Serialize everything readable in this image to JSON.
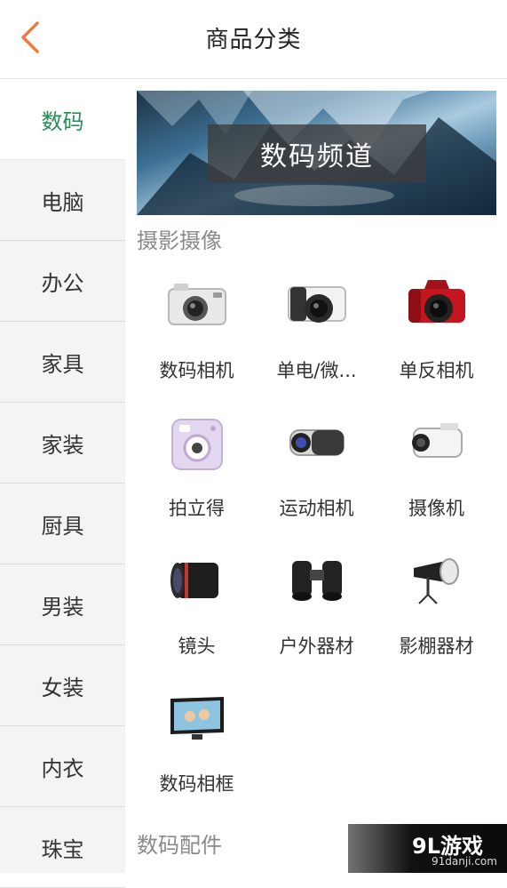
{
  "header": {
    "title": "商品分类",
    "back_icon": "chevron-left-icon",
    "accent": "#f07b3f"
  },
  "sidebar": {
    "active_color": "#2b8a57",
    "items": [
      {
        "label": "数码",
        "active": true
      },
      {
        "label": "电脑"
      },
      {
        "label": "办公"
      },
      {
        "label": "家具"
      },
      {
        "label": "家装"
      },
      {
        "label": "厨具"
      },
      {
        "label": "男装"
      },
      {
        "label": "女装"
      },
      {
        "label": "内衣"
      },
      {
        "label": "珠宝"
      }
    ]
  },
  "banner": {
    "text": "数码频道"
  },
  "sections": [
    {
      "title": "摄影摄像",
      "items": [
        {
          "label": "数码相机",
          "icon": "compact-camera-icon"
        },
        {
          "label": "单电/微...",
          "icon": "mirrorless-camera-icon"
        },
        {
          "label": "单反相机",
          "icon": "dslr-camera-icon"
        },
        {
          "label": "拍立得",
          "icon": "instant-camera-icon"
        },
        {
          "label": "运动相机",
          "icon": "action-camera-icon"
        },
        {
          "label": "摄像机",
          "icon": "camcorder-icon"
        },
        {
          "label": "镜头",
          "icon": "lens-icon"
        },
        {
          "label": "户外器材",
          "icon": "binoculars-icon"
        },
        {
          "label": "影棚器材",
          "icon": "studio-light-icon"
        },
        {
          "label": "数码相框",
          "icon": "photo-frame-icon"
        }
      ]
    },
    {
      "title": "数码配件",
      "items": []
    }
  ],
  "watermark": {
    "main": "9L游戏",
    "sub": "91danji.com"
  }
}
